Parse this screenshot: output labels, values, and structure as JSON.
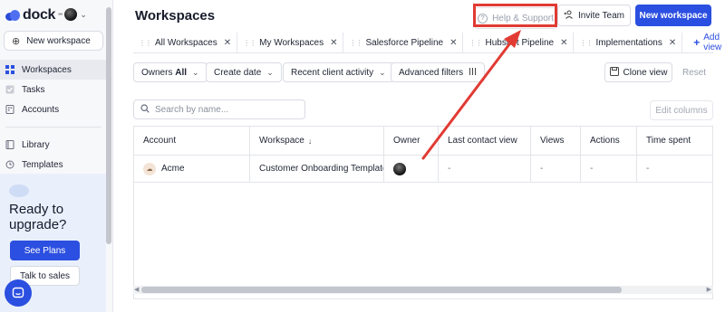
{
  "app": {
    "logo_text": "dock",
    "workspace_dots": "•••"
  },
  "sidebar": {
    "new_workspace": "New workspace",
    "items": [
      {
        "label": "Workspaces",
        "icon": "grid-icon",
        "active": true
      },
      {
        "label": "Tasks",
        "icon": "checkbox-icon",
        "active": false
      },
      {
        "label": "Accounts",
        "icon": "building-icon",
        "active": false
      },
      {
        "label": "Library",
        "icon": "book-icon",
        "active": false
      },
      {
        "label": "Templates",
        "icon": "template-icon",
        "active": false
      }
    ],
    "upgrade": {
      "title": "Ready to upgrade?",
      "see_plans": "See Plans",
      "talk_to_sales": "Talk to sales"
    }
  },
  "header": {
    "title": "Workspaces",
    "help": "Help & Support",
    "invite": "Invite Team",
    "new_workspace": "New workspace"
  },
  "tabs": [
    {
      "label": "All Workspaces",
      "active": true
    },
    {
      "label": "My Workspaces",
      "active": false
    },
    {
      "label": "Salesforce Pipeline",
      "active": false
    },
    {
      "label": "Hubspot Pipeline",
      "active": false
    },
    {
      "label": "Implementations",
      "active": false
    }
  ],
  "add_view": "Add view",
  "filters": {
    "owners_label": "Owners",
    "owners_value": "All",
    "create_date": "Create date",
    "recent_activity": "Recent client activity",
    "advanced": "Advanced filters",
    "clone_view": "Clone view",
    "reset": "Reset"
  },
  "search": {
    "placeholder": "Search by name..."
  },
  "edit_columns": "Edit columns",
  "table": {
    "columns": [
      "Account",
      "Workspace",
      "Owner",
      "Last contact view",
      "Views",
      "Actions",
      "Time spent"
    ],
    "sorted_column_arrow": "↓",
    "rows": [
      {
        "account": "Acme",
        "workspace": "Customer Onboarding Template",
        "last_contact_view": "-",
        "views": "-",
        "actions": "-",
        "time_spent": "-"
      }
    ]
  },
  "colors": {
    "brand": "#2b4fe0",
    "annotation": "#e13b33"
  }
}
